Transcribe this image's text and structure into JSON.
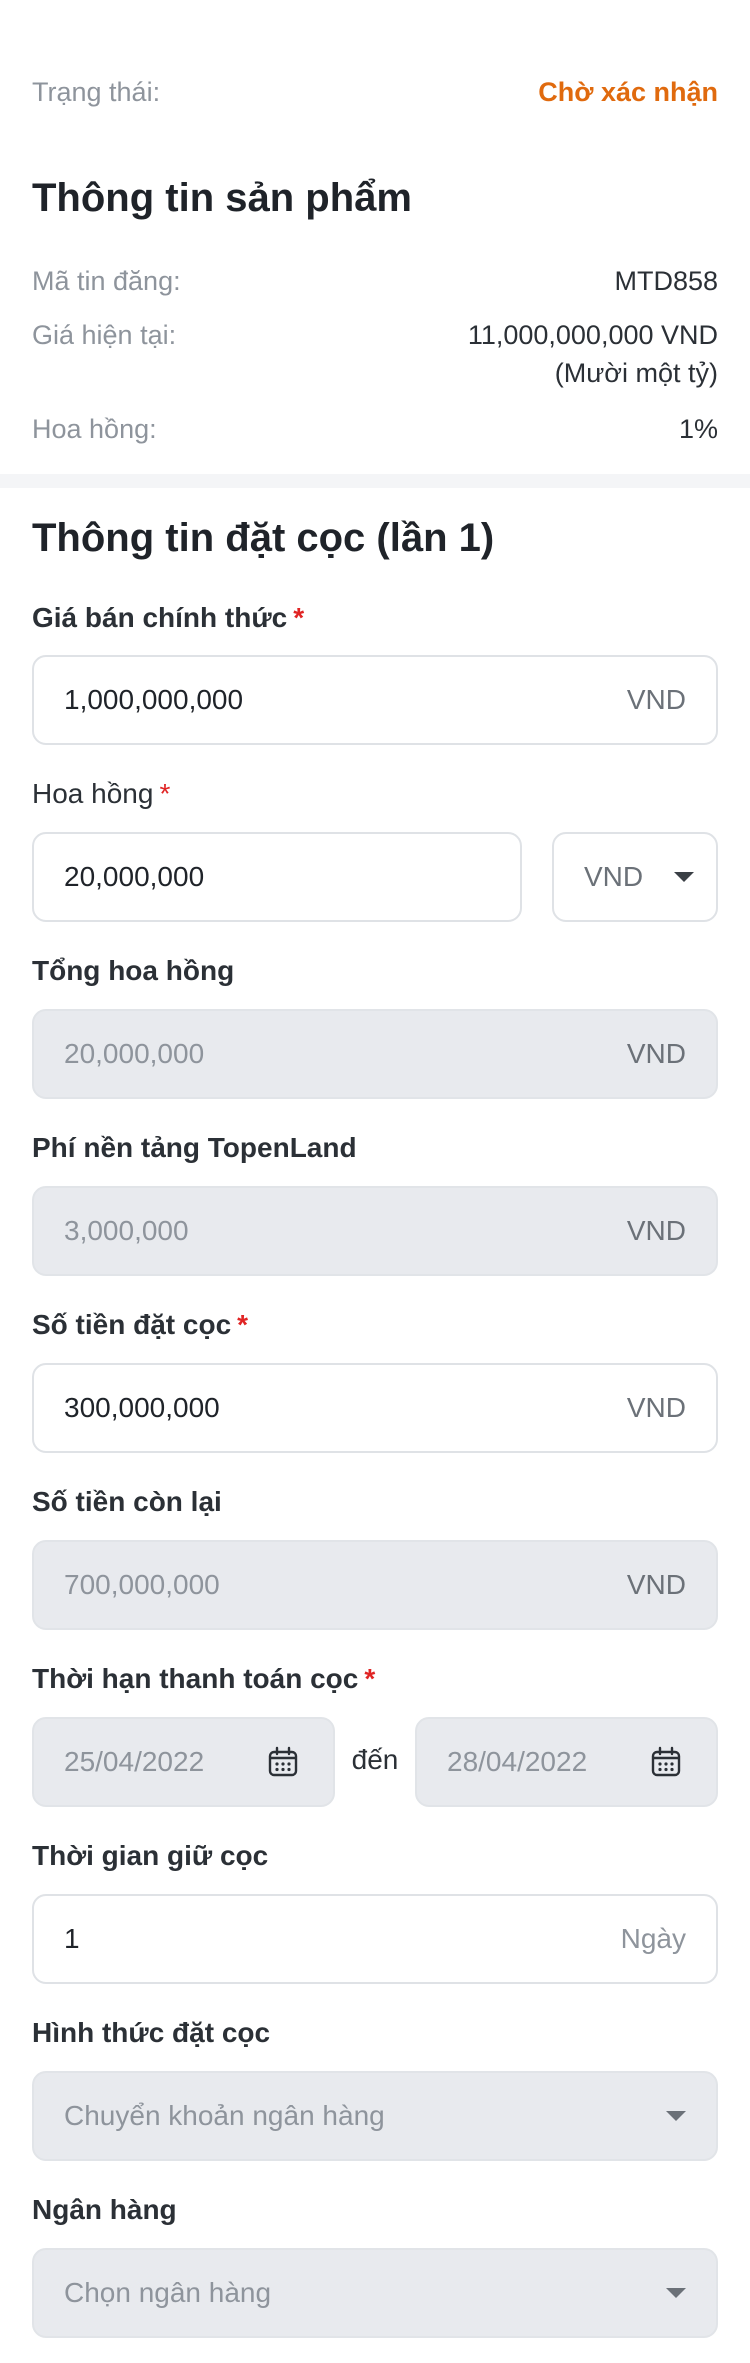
{
  "status": {
    "label": "Trạng thái:",
    "value": "Chờ xác nhận",
    "value_color": "#e06a0e"
  },
  "product": {
    "title": "Thông tin sản phẩm",
    "listing_code_label": "Mã tin đăng:",
    "listing_code": "MTD858",
    "current_price_label": "Giá hiện tại:",
    "current_price": "11,000,000,000 VND",
    "current_price_words": "(Mười một tỷ)",
    "commission_label": "Hoa hồng:",
    "commission": "1%"
  },
  "deposit": {
    "title": "Thông tin đặt cọc (lần 1)",
    "required_mark": "*",
    "official_price": {
      "label": "Giá bán chính thức",
      "value": "1,000,000,000",
      "unit": "VND"
    },
    "commission": {
      "label": "Hoa hồng",
      "value": "20,000,000",
      "unit_select": "VND"
    },
    "total_commission": {
      "label": "Tổng hoa hồng",
      "value": "20,000,000",
      "unit": "VND"
    },
    "platform_fee": {
      "label": "Phí nền tảng TopenLand",
      "value": "3,000,000",
      "unit": "VND"
    },
    "deposit_amount": {
      "label": "Số tiền đặt cọc",
      "value": "300,000,000",
      "unit": "VND"
    },
    "remaining": {
      "label": "Số tiền còn lại",
      "value": "700,000,000",
      "unit": "VND"
    },
    "payment_deadline": {
      "label": "Thời hạn thanh toán cọc",
      "from": "25/04/2022",
      "to_word": "đến",
      "to": "28/04/2022"
    },
    "hold_time": {
      "label": "Thời gian giữ cọc",
      "value": "1",
      "unit": "Ngày"
    },
    "method": {
      "label": "Hình thức đặt cọc",
      "value": "Chuyển khoản ngân hàng"
    },
    "bank": {
      "label": "Ngân hàng",
      "placeholder": "Chọn ngân hàng"
    }
  },
  "icons": {
    "calendar": "calendar-icon",
    "dropdown": "chevron-down-icon"
  }
}
